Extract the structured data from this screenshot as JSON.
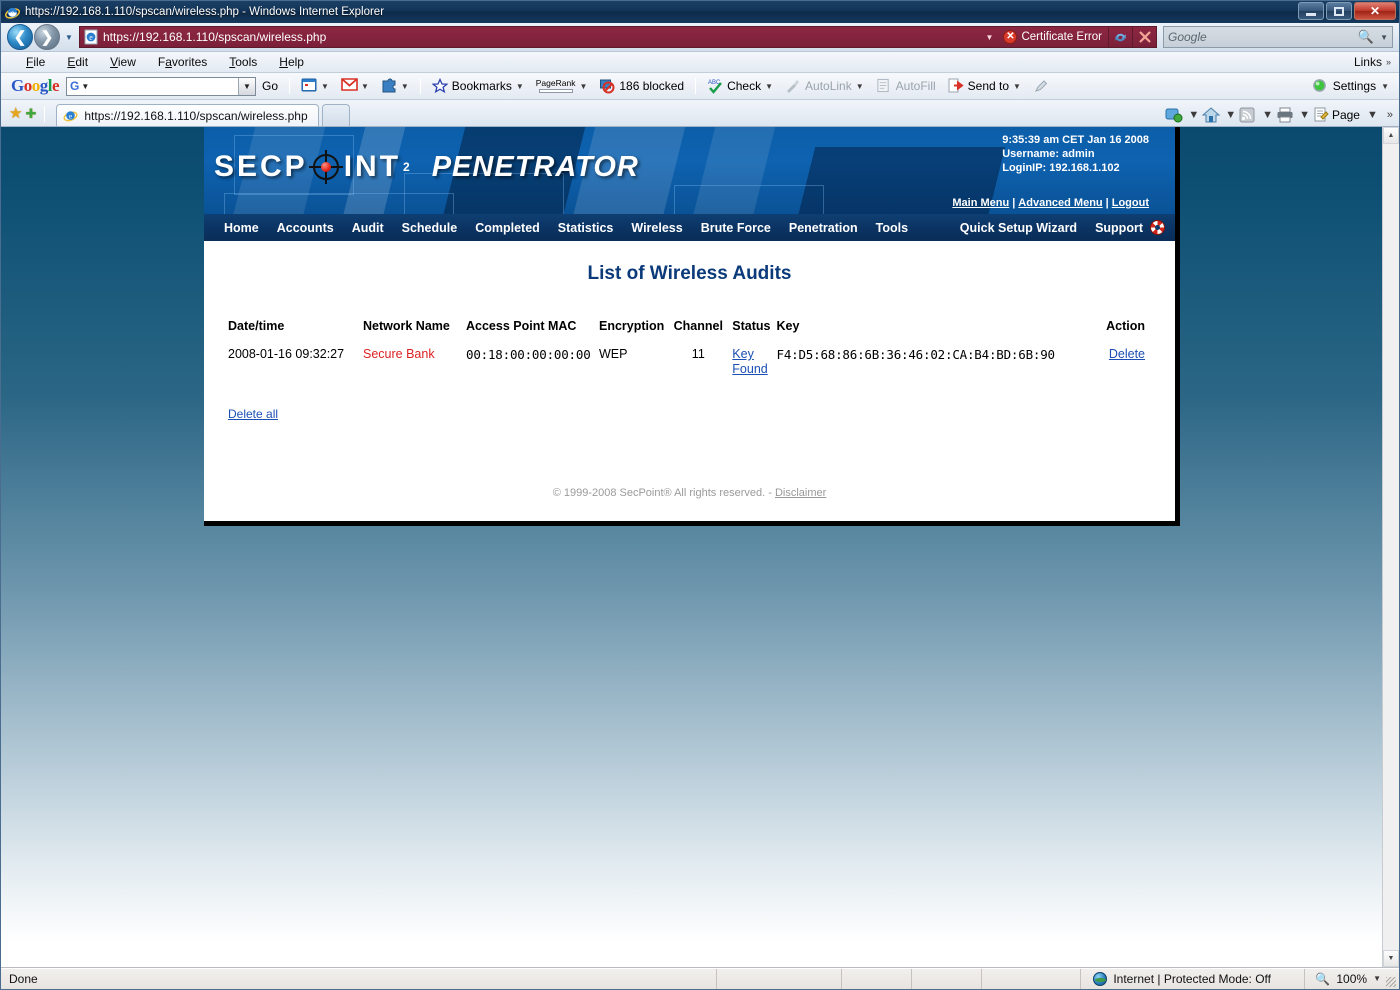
{
  "browser": {
    "window_title": "https://192.168.1.110/spscan/wireless.php - Windows Internet Explorer",
    "window_controls": {
      "minimize": "–",
      "maximize": "❐",
      "close": "✕"
    },
    "address": {
      "url": "https://192.168.1.110/spscan/wireless.php",
      "certificate_error": "Certificate Error",
      "refresh_label": "↻",
      "stop_label": "✕",
      "dropdown_label": "▼"
    },
    "search": {
      "placeholder": "Google",
      "value": ""
    },
    "menu": [
      {
        "label": "File"
      },
      {
        "label": "Edit"
      },
      {
        "label": "View"
      },
      {
        "label": "Favorites"
      },
      {
        "label": "Tools"
      },
      {
        "label": "Help"
      }
    ],
    "links_button": "Links",
    "google_toolbar": {
      "logo": [
        "G",
        "o",
        "o",
        "g",
        "l",
        "e"
      ],
      "search_value": "",
      "go_label": "Go",
      "bookmarks_label": "Bookmarks",
      "pagerank_label": "PageRank",
      "blocked_label": "186 blocked",
      "check_label": "Check",
      "autolink_label": "AutoLink",
      "autofill_label": "AutoFill",
      "sendto_label": "Send to",
      "settings_label": "Settings"
    },
    "tab": {
      "label": "https://192.168.1.110/spscan/wireless.php"
    },
    "command_bar": {
      "page_label": "Page",
      "overflow": "»"
    },
    "status": {
      "text": "Done",
      "zone": "Internet | Protected Mode: Off",
      "zoom": "100%"
    }
  },
  "app": {
    "logo": {
      "brand": "SECP",
      "brand_tail": "INT",
      "trademark": "2",
      "product": "PENETRATOR"
    },
    "session": {
      "datetime": "9:35:39 am CET Jan 16 2008",
      "username": "Username: admin",
      "loginip": "LoginIP: 192.168.1.102"
    },
    "header_links": [
      {
        "label": "Main Menu"
      },
      {
        "label": "Advanced Menu"
      },
      {
        "label": "Logout"
      }
    ],
    "nav": [
      {
        "label": "Home"
      },
      {
        "label": "Accounts"
      },
      {
        "label": "Audit"
      },
      {
        "label": "Schedule"
      },
      {
        "label": "Completed"
      },
      {
        "label": "Statistics"
      },
      {
        "label": "Wireless"
      },
      {
        "label": "Brute Force"
      },
      {
        "label": "Penetration"
      },
      {
        "label": "Tools"
      }
    ],
    "nav_right": [
      {
        "label": "Quick Setup Wizard"
      },
      {
        "label": "Support"
      }
    ],
    "page_title": "List of Wireless Audits",
    "table": {
      "headers": {
        "date": "Date/time",
        "network": "Network Name",
        "mac": "Access Point MAC",
        "encryption": "Encryption",
        "channel": "Channel",
        "status": "Status",
        "key": "Key",
        "action": "Action"
      },
      "rows": [
        {
          "date": "2008-01-16 09:32:27",
          "network": "Secure Bank",
          "mac": "00:18:00:00:00:00",
          "encryption": "WEP",
          "channel": "11",
          "status": "Key Found",
          "key": "F4:D5:68:86:6B:36:46:02:CA:B4:BD:6B:90",
          "action": "Delete"
        }
      ]
    },
    "delete_all": "Delete all",
    "footer": {
      "copyright": "© 1999-2008 SecPoint® All rights reserved. -",
      "disclaimer": "Disclaimer"
    }
  },
  "colors": {
    "brand_blue": "#0c5ea8",
    "nav_blue": "#0b3362",
    "title_blue": "#0b3a7a",
    "link_blue": "#1a4fb4",
    "network_red": "#dd2222",
    "address_maroon": "#8d2742"
  }
}
